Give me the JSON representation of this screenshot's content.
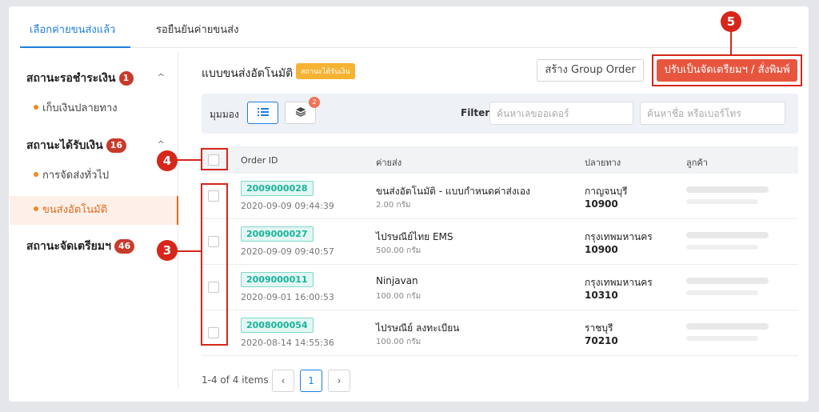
{
  "tabs": [
    {
      "label": "เลือกค่ายขนส่งแล้ว"
    },
    {
      "label": "รอยืนยันค่ายขนส่ง"
    }
  ],
  "sidebar": {
    "groups": [
      {
        "label": "สถานะรอชำระเงิน",
        "count": "1"
      },
      {
        "label": "สถานะได้รับเงิน",
        "count": "16"
      },
      {
        "label": "สถานะจัดเตรียมฯ",
        "count": "46"
      }
    ],
    "items": [
      {
        "label": "เก็บเงินปลายทาง"
      },
      {
        "label": "การจัดส่งทั่วไป"
      },
      {
        "label": "ขนส่งอัตโนมัติ"
      }
    ]
  },
  "header": {
    "title": "แบบขนส่งอัตโนมัติ",
    "status_chip": "สถานะได้รับเงิน",
    "group_order_btn": "สร้าง Group Order",
    "confirm_btn": "ปรับเป็นจัดเตรียมฯ / สั่งพิมพ์"
  },
  "filter": {
    "view_label": "มุมมอง",
    "layers_badge": "2",
    "filter_label": "Filter",
    "order_placeholder": "ค้นหาเลขออเดอร์",
    "name_placeholder": "ค้นหาชื่อ หรือเบอร์โทร"
  },
  "table": {
    "columns": [
      "Order ID",
      "ค่ายส่ง",
      "ปลายทาง",
      "ลูกค้า"
    ],
    "rows": [
      {
        "order_id": "2009000028",
        "time": "2020-09-09 09:44:39",
        "carrier": "ขนส่งอัตโนมัติ - แบบกำหนดค่าส่งเอง",
        "weight": "2.00 กรัม",
        "dest": "กาญจนบุรี",
        "zip": "10900"
      },
      {
        "order_id": "2009000027",
        "time": "2020-09-09 09:40:57",
        "carrier": "ไปรษณีย์ไทย EMS",
        "weight": "500.00 กรัม",
        "dest": "กรุงเทพมหานคร",
        "zip": "10900"
      },
      {
        "order_id": "2009000011",
        "time": "2020-09-01 16:00:53",
        "carrier": "Ninjavan",
        "weight": "100.00 กรัม",
        "dest": "กรุงเทพมหานคร",
        "zip": "10310"
      },
      {
        "order_id": "2008000054",
        "time": "2020-08-14 14:55:36",
        "carrier": "ไปรษณีย์ ลงทะเบียน",
        "weight": "100.00 กรัม",
        "dest": "ราชบุรี",
        "zip": "70210"
      }
    ]
  },
  "pagination": {
    "info": "1-4 of 4 items",
    "prev": "‹",
    "page": "1",
    "next": "›"
  },
  "annotations": {
    "a3": "3",
    "a4": "4",
    "a5": "5"
  },
  "colors": {
    "accent": "#1d7fe0",
    "confirm": "#e8553f",
    "annotation": "#d7261a",
    "orderid": "#19b39a"
  }
}
